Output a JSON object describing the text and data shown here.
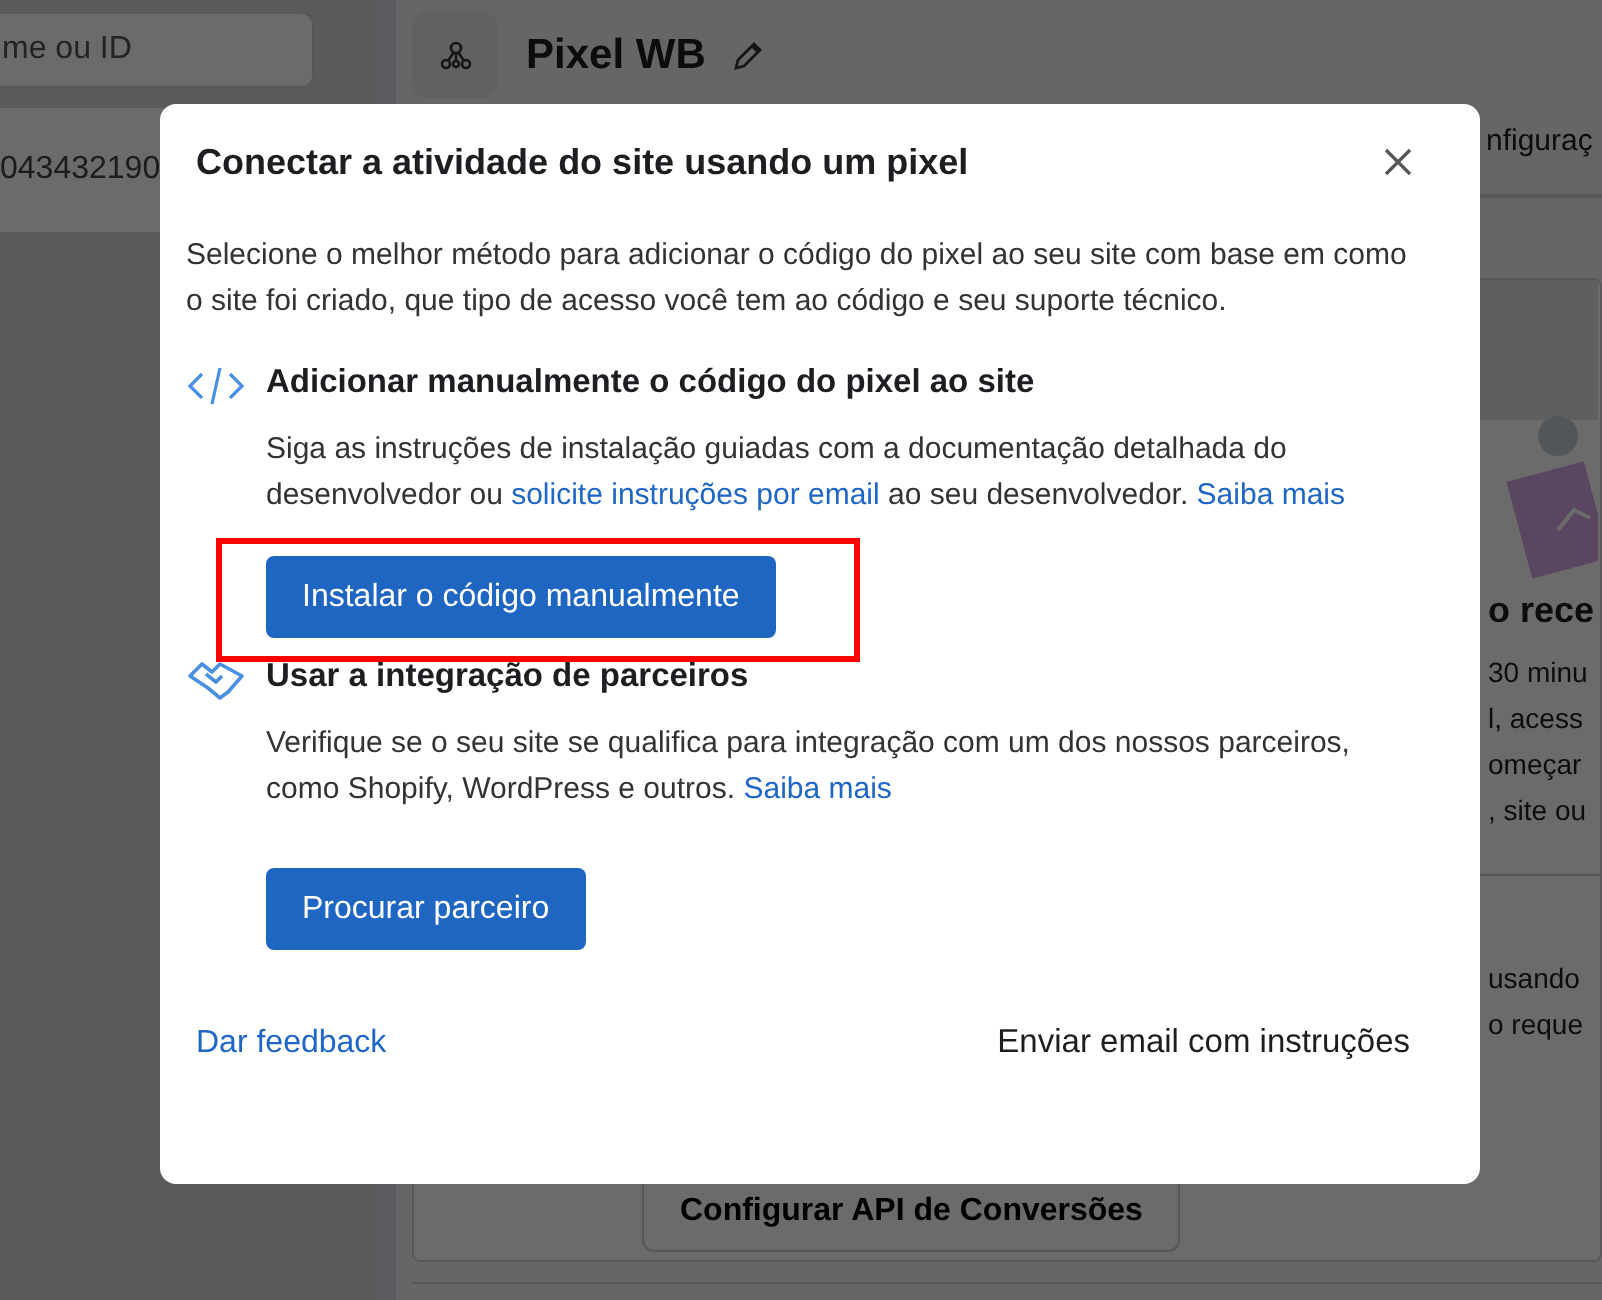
{
  "sidebar": {
    "search": {
      "placeholder": "me ou ID"
    },
    "items": [
      {
        "label": "043432190",
        "selected": true
      }
    ]
  },
  "pixel": {
    "title": "Pixel WB",
    "tab": "nfiguraç",
    "heading": "o rece",
    "lines": [
      "30 minu",
      "l, acess",
      "omeçar",
      ", site ou"
    ],
    "lines2": [
      "usando",
      "o reque"
    ],
    "button": "Configurar API de Conversões"
  },
  "dialog": {
    "title": "Conectar a atividade do site usando um pixel",
    "intro": "Selecione o melhor método para adicionar o código do pixel ao seu site com base em como o site foi criado, que tipo de acesso você tem ao código e seu suporte técnico.",
    "options": [
      {
        "kind": "code",
        "title": "Adicionar manualmente o código do pixel ao site",
        "highlighted": true,
        "parts": [
          {
            "kind": "text",
            "text": "Siga as instruções de instalação guiadas com a documentação detalhada do desenvolvedor ou "
          },
          {
            "kind": "link",
            "text": "solicite instruções por email"
          },
          {
            "kind": "text",
            "text": " ao seu desenvolvedor. "
          },
          {
            "kind": "link",
            "text": "Saiba mais"
          }
        ],
        "button": "Instalar o código manualmente"
      },
      {
        "kind": "partners",
        "title": "Usar a integração de parceiros",
        "highlighted": false,
        "parts": [
          {
            "kind": "text",
            "text": "Verifique se o seu site se qualifica para integração com um dos nossos parceiros, como Shopify, WordPress e outros. "
          },
          {
            "kind": "link",
            "text": "Saiba mais"
          }
        ],
        "button": "Procurar parceiro"
      }
    ],
    "feedback": "Dar feedback",
    "email": "Enviar email com instruções"
  }
}
